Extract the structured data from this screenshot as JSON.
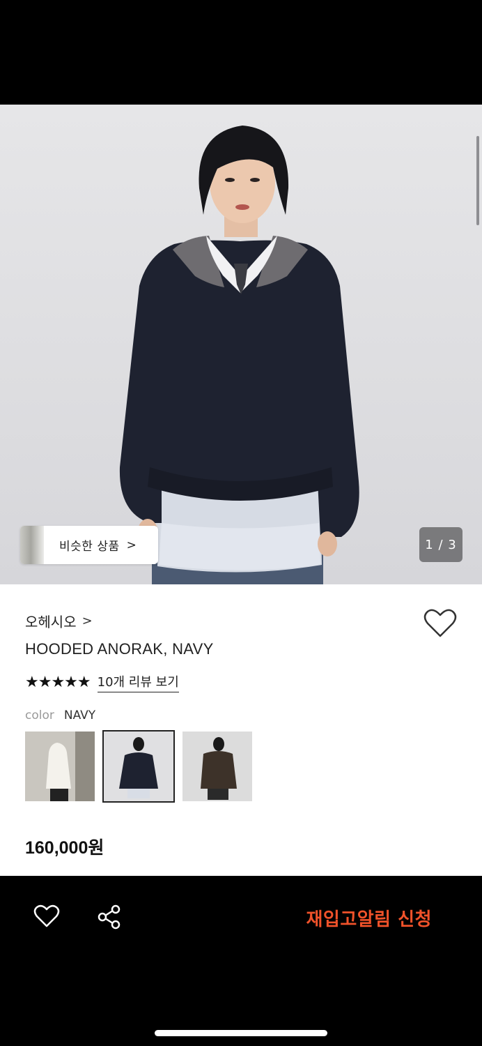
{
  "hero": {
    "similar_products_label": "비슷한 상품",
    "similar_chevron": ">",
    "page_counter": "1 / 3"
  },
  "product": {
    "brand": "오헤시오",
    "brand_chevron": ">",
    "name": "HOODED ANORAK, NAVY",
    "stars": "★★★★★",
    "review_link": "10개 리뷰 보기",
    "color_label": "color",
    "color_value": "NAVY",
    "price": "160,000원"
  },
  "bottom_bar": {
    "restock_label": "재입고알림 신청"
  },
  "colors": {
    "accent": "#f0522a",
    "navy": "#1d2230"
  }
}
